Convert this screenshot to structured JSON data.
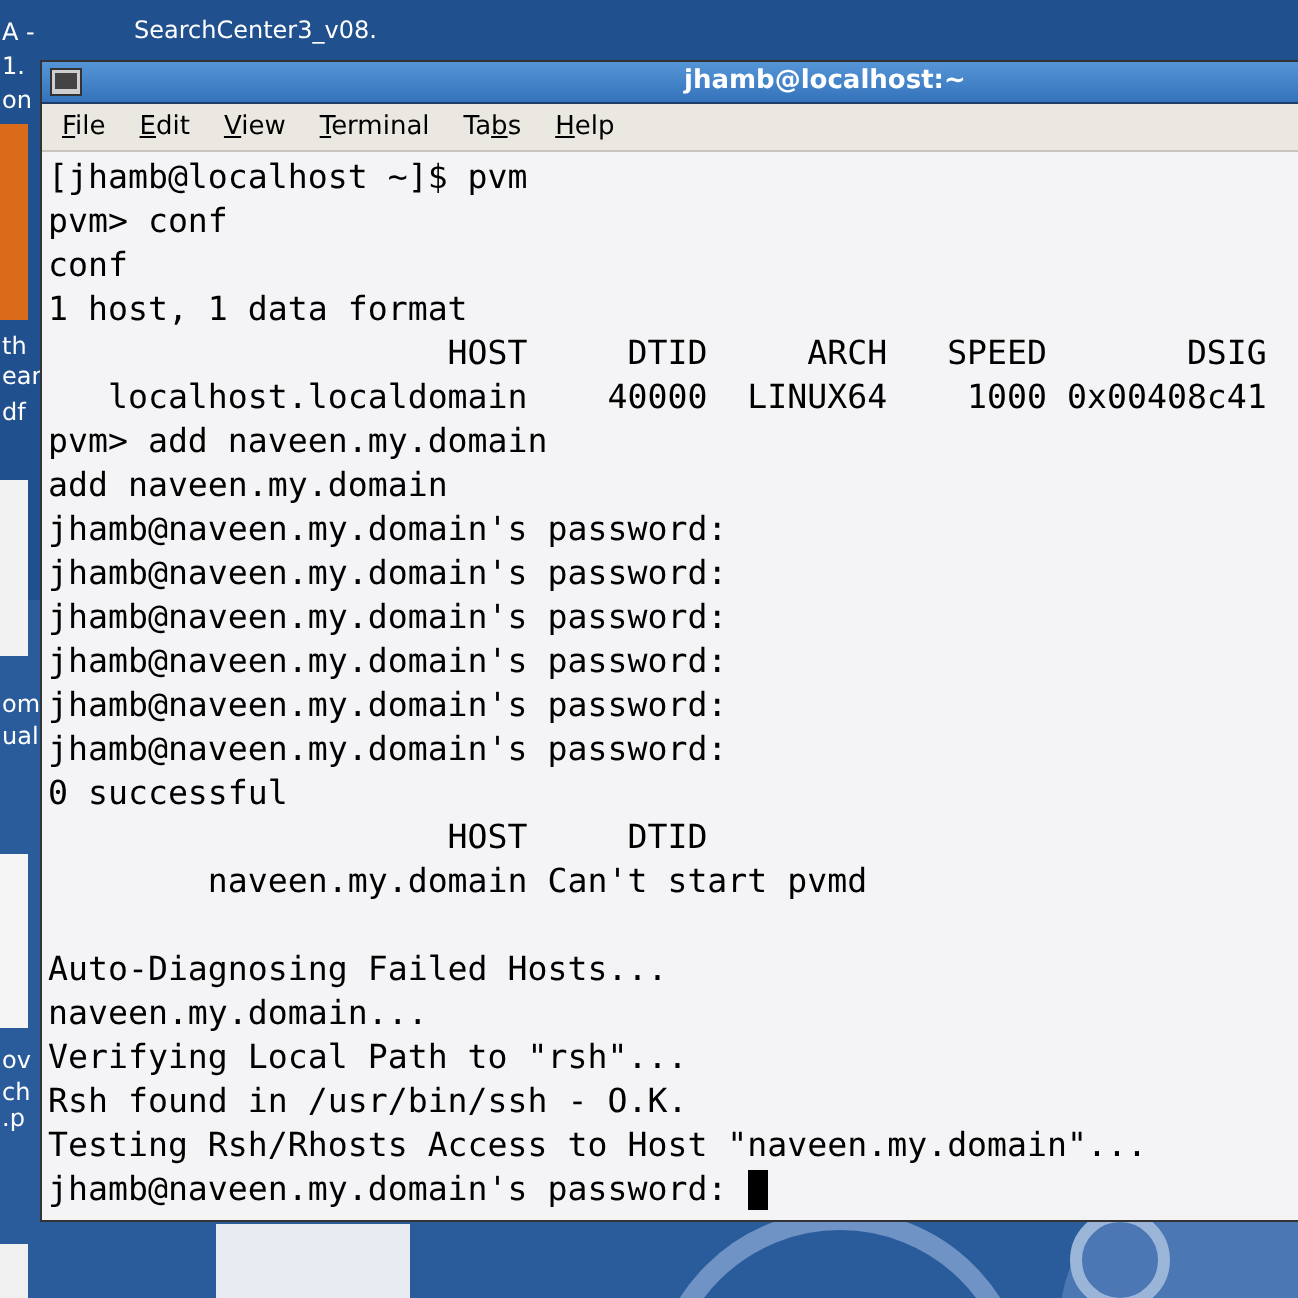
{
  "desktop": {
    "file_label": "SearchCenter3_v08.",
    "icon_labels": [
      {
        "text": "A -"
      },
      {
        "text": "1."
      },
      {
        "text": "on"
      },
      {
        "text": "th"
      },
      {
        "text": "ear"
      },
      {
        "text": "df"
      },
      {
        "text": "om"
      },
      {
        "text": "ual"
      },
      {
        "text": "ov"
      },
      {
        "text": "ch"
      },
      {
        "text": ".p"
      }
    ]
  },
  "window": {
    "title": "jhamb@localhost:~",
    "menu": [
      {
        "key": "F",
        "rest": "ile"
      },
      {
        "key": "E",
        "rest": "dit"
      },
      {
        "key": "V",
        "rest": "iew"
      },
      {
        "key": "T",
        "rest": "erminal"
      },
      {
        "pre": "Ta",
        "key": "b",
        "rest": "s"
      },
      {
        "key": "H",
        "rest": "elp"
      }
    ],
    "terminal": {
      "cursor_visible": true,
      "blocks": [
        {
          "lines": [
            "[jhamb@localhost ~]$ pvm",
            "pvm> conf",
            "conf",
            "1 host, 1 data format",
            "                    HOST     DTID     ARCH   SPEED       DSIG",
            "   localhost.localdomain    40000  LINUX64    1000 0x00408c41",
            "pvm> add naveen.my.domain",
            "add naveen.my.domain",
            "jhamb@naveen.my.domain's password:",
            "jhamb@naveen.my.domain's password:",
            "jhamb@naveen.my.domain's password:",
            "jhamb@naveen.my.domain's password:",
            "jhamb@naveen.my.domain's password:",
            "jhamb@naveen.my.domain's password:",
            "0 successful",
            "                    HOST     DTID",
            "        naveen.my.domain Can't start pvmd"
          ]
        },
        {
          "lines": [
            "Auto-Diagnosing Failed Hosts...",
            "naveen.my.domain...",
            "Verifying Local Path to \"rsh\"...",
            "Rsh found in /usr/bin/ssh - O.K.",
            "Testing Rsh/Rhosts Access to Host \"naveen.my.domain\"...",
            "jhamb@naveen.my.domain's password: "
          ]
        }
      ]
    }
  }
}
